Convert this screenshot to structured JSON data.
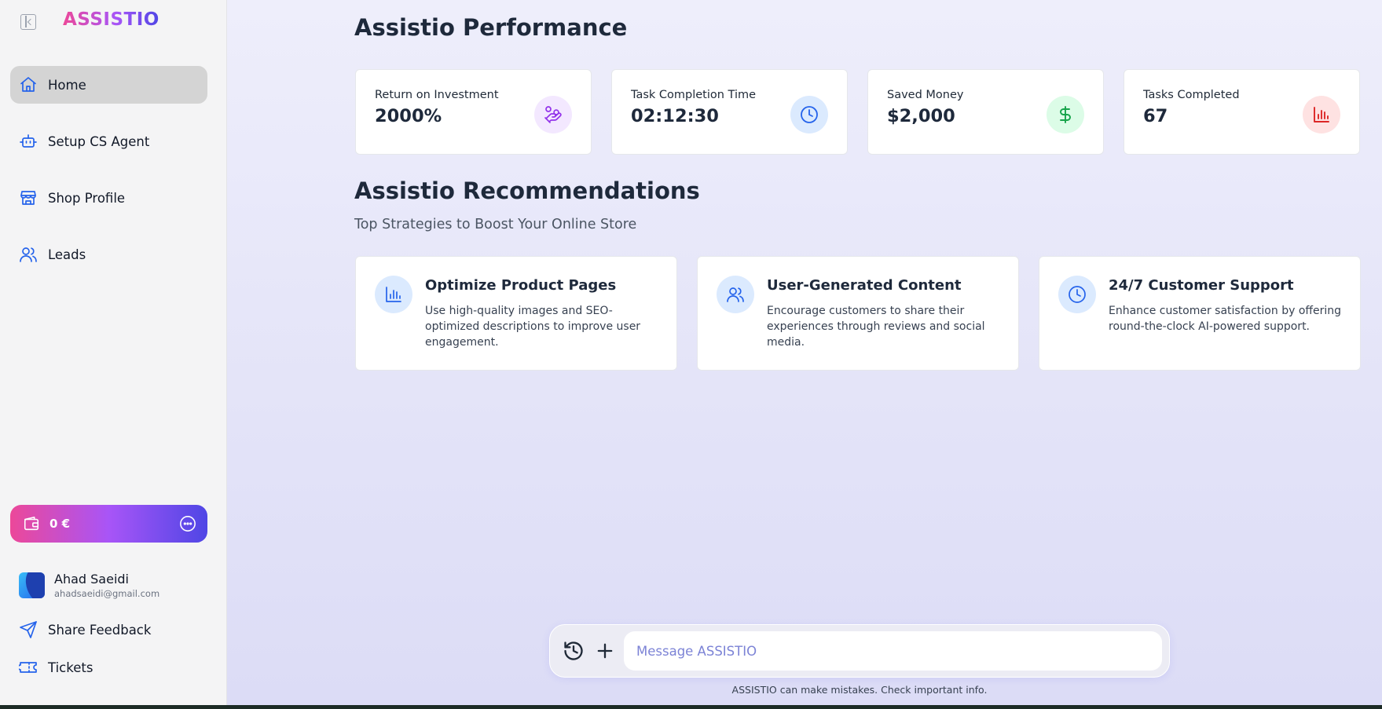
{
  "app": {
    "logo": "ASSISTIO"
  },
  "sidebar": {
    "items": [
      {
        "label": "Home",
        "icon": "home-icon",
        "active": true
      },
      {
        "label": "Setup CS Agent",
        "icon": "bot-icon"
      },
      {
        "label": "Shop Profile",
        "icon": "store-icon"
      },
      {
        "label": "Leads",
        "icon": "users-icon"
      }
    ],
    "wallet": {
      "amount": "0 €"
    },
    "user": {
      "name": "Ahad Saeidi",
      "email": "ahadsaeidi@gmail.com"
    },
    "footer": [
      {
        "label": "Share Feedback",
        "icon": "send-icon"
      },
      {
        "label": "Tickets",
        "icon": "ticket-icon"
      }
    ]
  },
  "main": {
    "performance_title": "Assistio Performance",
    "stats": [
      {
        "title": "Return on Investment",
        "value": "2000%",
        "icon": "hand-coins-icon",
        "color": "#9333ea",
        "bg": "#f3e8ff"
      },
      {
        "title": "Task Completion Time",
        "value": "02:12:30",
        "icon": "clock-icon",
        "color": "#2563eb",
        "bg": "#dbeafe"
      },
      {
        "title": "Saved Money",
        "value": "$2,000",
        "icon": "dollar-icon",
        "color": "#16a34a",
        "bg": "#dcfce7"
      },
      {
        "title": "Tasks Completed",
        "value": "67",
        "icon": "bar-chart-icon",
        "color": "#dc2626",
        "bg": "#fee2e2"
      }
    ],
    "recommendations_title": "Assistio Recommendations",
    "recommendations_subtitle": "Top Strategies to Boost Your Online Store",
    "recommendations": [
      {
        "title": "Optimize Product Pages",
        "description": "Use high-quality images and SEO-optimized descriptions to improve user engagement.",
        "icon": "bar-chart-icon"
      },
      {
        "title": "User-Generated Content",
        "description": "Encourage customers to share their experiences through reviews and social media.",
        "icon": "users-icon"
      },
      {
        "title": "24/7 Customer Support",
        "description": "Enhance customer satisfaction by offering round-the-clock AI-powered support.",
        "icon": "clock-icon"
      }
    ]
  },
  "chat": {
    "placeholder": "Message ASSISTIO",
    "disclaimer": "ASSISTIO can make mistakes. Check important info."
  },
  "colors": {
    "accent": "#2563eb",
    "brand_gradient": [
      "#ec4899",
      "#a855f7",
      "#4f46e5"
    ]
  }
}
